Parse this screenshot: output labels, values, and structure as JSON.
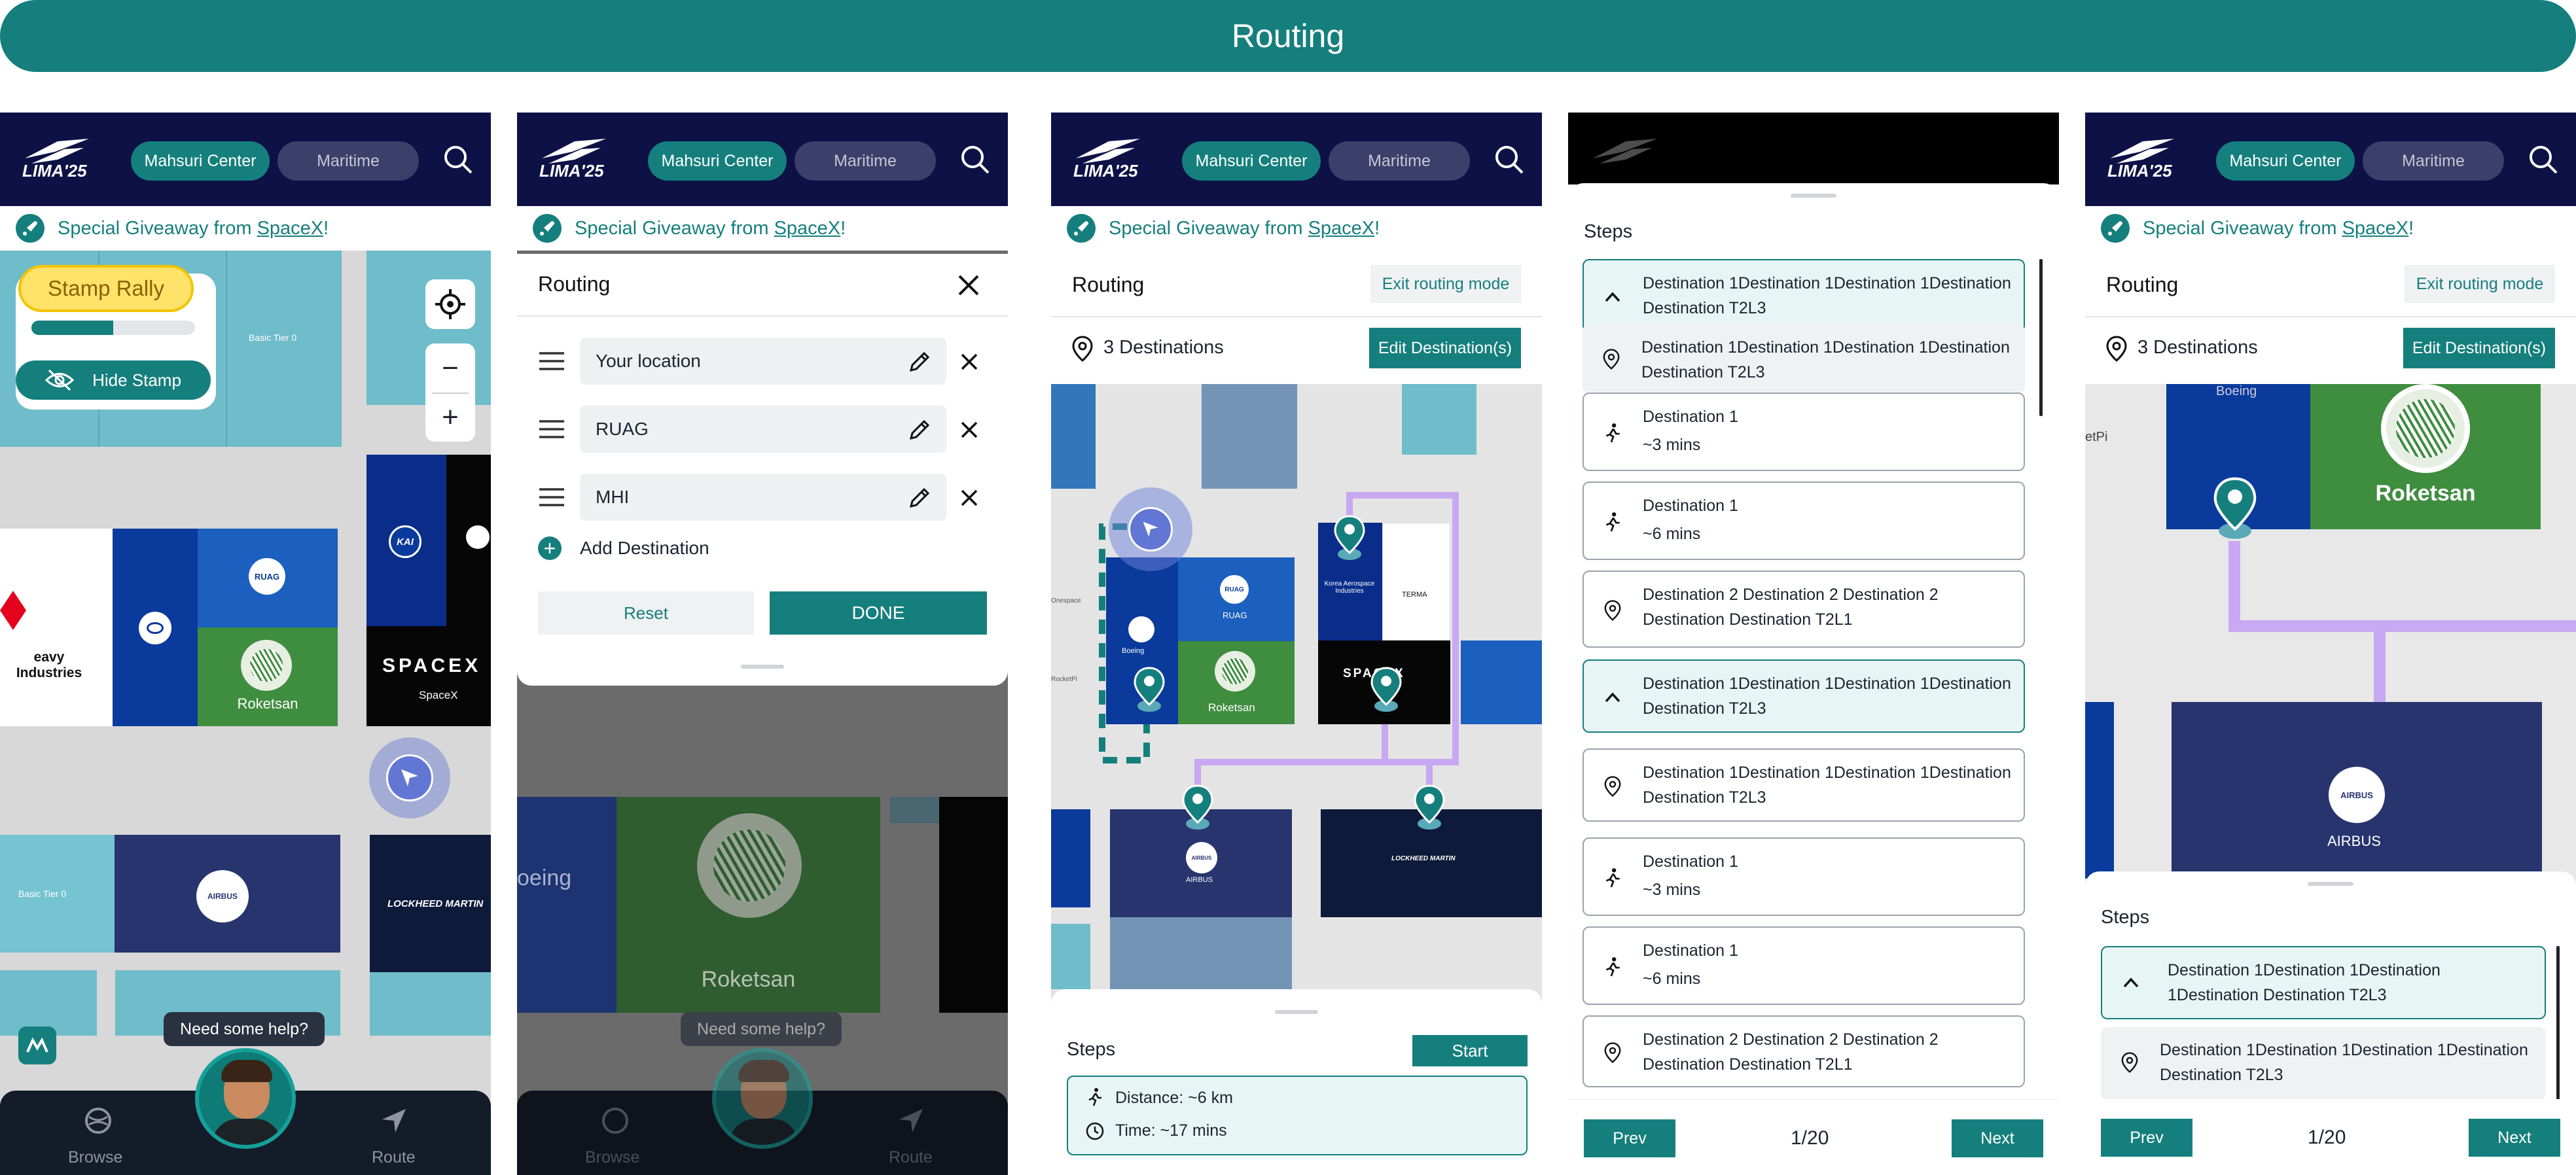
{
  "banner": {
    "title": "Routing"
  },
  "header": {
    "tab_active": "Mahsuri Center",
    "tab_inactive": "Maritime",
    "logo": "LIMA'25"
  },
  "giveaway": {
    "prefix": "Special Giveaway from",
    "brand": "SpaceX",
    "suffix": "!"
  },
  "screen1": {
    "stamp_title": "Stamp Rally",
    "stamp_progress": 0.5,
    "hide_stamp": "Hide Stamp",
    "zoom_in": "+",
    "zoom_out": "−",
    "booths": {
      "basic1": "Basic Tier 0",
      "basic2": "Basic Tier 0",
      "heavy": "eavy Industries",
      "ruag": "RUAG",
      "roketsan": "Roketsan",
      "spacex": "SPACEX",
      "spacex_sub": "SpaceX",
      "airbus": "AIRBUS",
      "lockheed": "LOCKHEED MARTIN",
      "kai": "KAI"
    },
    "help": "Need some help?",
    "nav_browse": "Browse",
    "nav_route": "Route"
  },
  "screen2": {
    "title": "Routing",
    "stops": [
      "Your location",
      "RUAG",
      "MHI"
    ],
    "add": "Add Destination",
    "reset": "Reset",
    "done": "DONE",
    "bg_boeing": "oeing",
    "bg_roketsan": "Roketsan",
    "help": "Need some help?",
    "nav_browse": "Browse",
    "nav_route": "Route"
  },
  "screen3": {
    "title": "Routing",
    "exit": "Exit routing mode",
    "dest_count": "3 Destinations",
    "edit": "Edit Destination(s)",
    "steps_label": "Steps",
    "start": "Start",
    "distance": "Distance: ~6 km",
    "time": "Time: ~17 mins",
    "booths": {
      "ruag": "RUAG",
      "boeing": "Boeing",
      "roketsan": "Roketsan",
      "kai": "Korea Aerospace Industries",
      "terma": "TERMA",
      "airbus": "AIRBUS",
      "lockheed": "LOCKHEED MARTIN",
      "spacex": "SPACEX",
      "onespace": "Onespace",
      "rocketpi": "RocketPi"
    }
  },
  "screen4": {
    "steps_label": "Steps",
    "steps": [
      {
        "type": "expanded",
        "text": "Destination 1Destination 1Destination 1Destination Destination T2L3"
      },
      {
        "type": "selected",
        "text": "Destination 1Destination 1Destination 1Destination Destination T2L3"
      },
      {
        "type": "walk",
        "text": "Destination 1",
        "sub": "~3 mins"
      },
      {
        "type": "walk",
        "text": "Destination 1",
        "sub": "~6 mins"
      },
      {
        "type": "pin",
        "text": "Destination 2 Destination 2 Destination 2 Destination Destination T2L1"
      },
      {
        "type": "expanded",
        "text": "Destination 1Destination 1Destination 1Destination Destination T2L3"
      },
      {
        "type": "pin",
        "text": "Destination 1Destination 1Destination 1Destination Destination T2L3"
      },
      {
        "type": "walk",
        "text": "Destination 1",
        "sub": "~3 mins"
      },
      {
        "type": "walk",
        "text": "Destination 1",
        "sub": "~6 mins"
      },
      {
        "type": "pin",
        "text": "Destination 2 Destination 2 Destination 2 Destination Destination T2L1"
      }
    ],
    "prev": "Prev",
    "page": "1/20",
    "next": "Next"
  },
  "screen5": {
    "title": "Routing",
    "exit": "Exit routing mode",
    "dest_count": "3 Destinations",
    "edit": "Edit Destination(s)",
    "steps_label": "Steps",
    "steps": [
      {
        "text": "Destination 1Destination 1Destination 1Destination Destination T2L3"
      },
      {
        "text": "Destination 1Destination 1Destination 1Destination Destination T2L3"
      }
    ],
    "booths": {
      "boeing": "Boeing",
      "roketsan": "Roketsan",
      "airbus": "AIRBUS",
      "etpi": "etPi"
    },
    "prev": "Prev",
    "page": "1/20",
    "next": "Next"
  },
  "colors": {
    "brand": "#157f7d",
    "navy": "#0d1146"
  }
}
